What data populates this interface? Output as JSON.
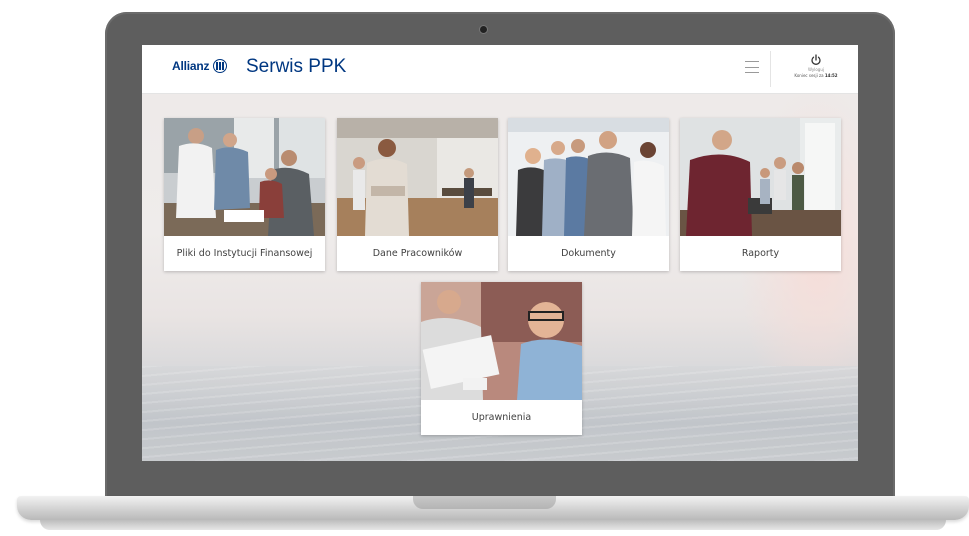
{
  "app": {
    "logo_text": "Allianz",
    "title": "Serwis PPK"
  },
  "header": {
    "logout_label": "Wyloguj",
    "session_text": "Koniec sesji za",
    "session_time": "14:52"
  },
  "tiles": [
    {
      "label": "Pliki do Instytucji Finansowej",
      "icon": "photo-business-handshake"
    },
    {
      "label": "Dane Pracowników",
      "icon": "photo-employee-office"
    },
    {
      "label": "Dokumenty",
      "icon": "photo-team-group"
    },
    {
      "label": "Raporty",
      "icon": "photo-tablet-office"
    },
    {
      "label": "Uprawnienia",
      "icon": "photo-signing-document"
    }
  ],
  "colors": {
    "brand": "#003781",
    "laptop_frame": "#5e5e5e",
    "tile_text": "#414141"
  }
}
